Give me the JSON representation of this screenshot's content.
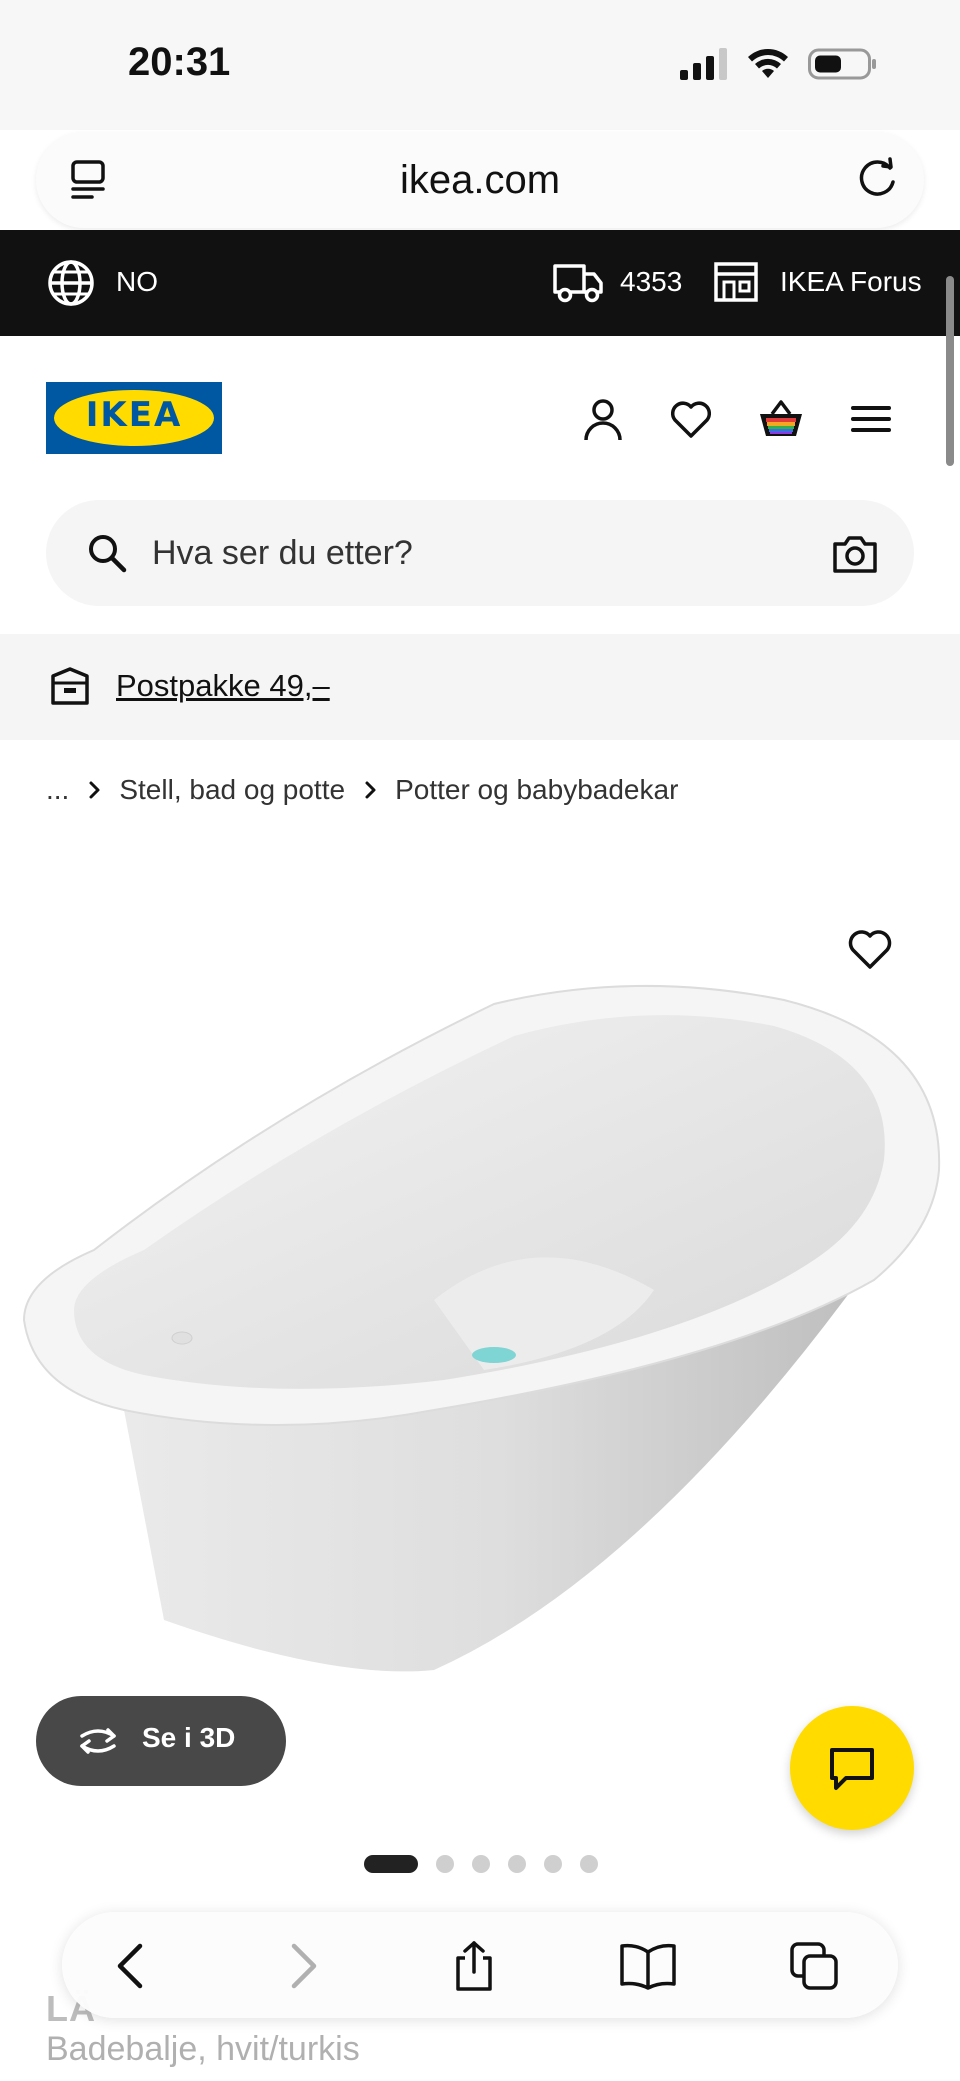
{
  "status_bar": {
    "time": "20:31"
  },
  "browser": {
    "url": "ikea.com"
  },
  "top_strip": {
    "language": "NO",
    "postcode": "4353",
    "store": "IKEA Forus"
  },
  "header": {
    "logo_text": "IKEA"
  },
  "search": {
    "placeholder": "Hva ser du etter?"
  },
  "promo": {
    "label": "Postpakke 49,–"
  },
  "breadcrumb": [
    "...",
    "Stell, bad og potte",
    "Potter og babybadekar"
  ],
  "product": {
    "view_3d_label": "Se i 3D",
    "image_count": 6,
    "active_image": 1,
    "name_partial": "LÄ",
    "description": "Badebalje, hvit/turkis"
  },
  "colors": {
    "brand_blue": "#0058a3",
    "brand_yellow": "#ffdb00",
    "strip_black": "#111111"
  },
  "icons": [
    "tabs-icon",
    "reload-icon",
    "globe-icon",
    "truck-icon",
    "store-icon",
    "user-icon",
    "heart-icon",
    "basket-icon",
    "menu-icon",
    "search-icon",
    "camera-icon",
    "parcel-icon",
    "chevron-right-icon",
    "rotate-3d-icon",
    "chat-icon",
    "back-icon",
    "forward-icon",
    "share-icon",
    "bookmarks-icon",
    "tabs-overview-icon"
  ]
}
